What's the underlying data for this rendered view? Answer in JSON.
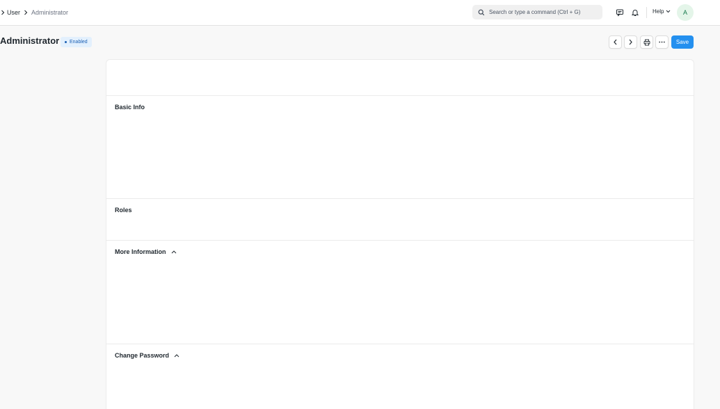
{
  "breadcrumb": {
    "items": [
      "User",
      "Administrator"
    ]
  },
  "search": {
    "placeholder": "Search or type a command (Ctrl + G)"
  },
  "header": {
    "help_label": "Help",
    "avatar_initial": "A"
  },
  "page": {
    "title": "Administrator",
    "status": "Enabled",
    "save_label": "Save"
  },
  "sections": [
    {
      "title": "Basic Info",
      "collapsible": false
    },
    {
      "title": "Roles",
      "collapsible": false
    },
    {
      "title": "More Information",
      "collapsible": true
    },
    {
      "title": "Change Password",
      "collapsible": true
    }
  ],
  "colors": {
    "primary": "#2490ef",
    "badge_bg": "#e3f0fd",
    "badge_text": "#1a5fb4",
    "avatar_bg": "#e4f5e9",
    "avatar_text": "#16794c"
  },
  "icons": [
    "chevron-right-icon",
    "search-icon",
    "chat-icon",
    "bell-icon",
    "chevron-down-icon",
    "chevron-left-icon",
    "printer-icon",
    "ellipsis-icon",
    "chevron-up-icon"
  ]
}
